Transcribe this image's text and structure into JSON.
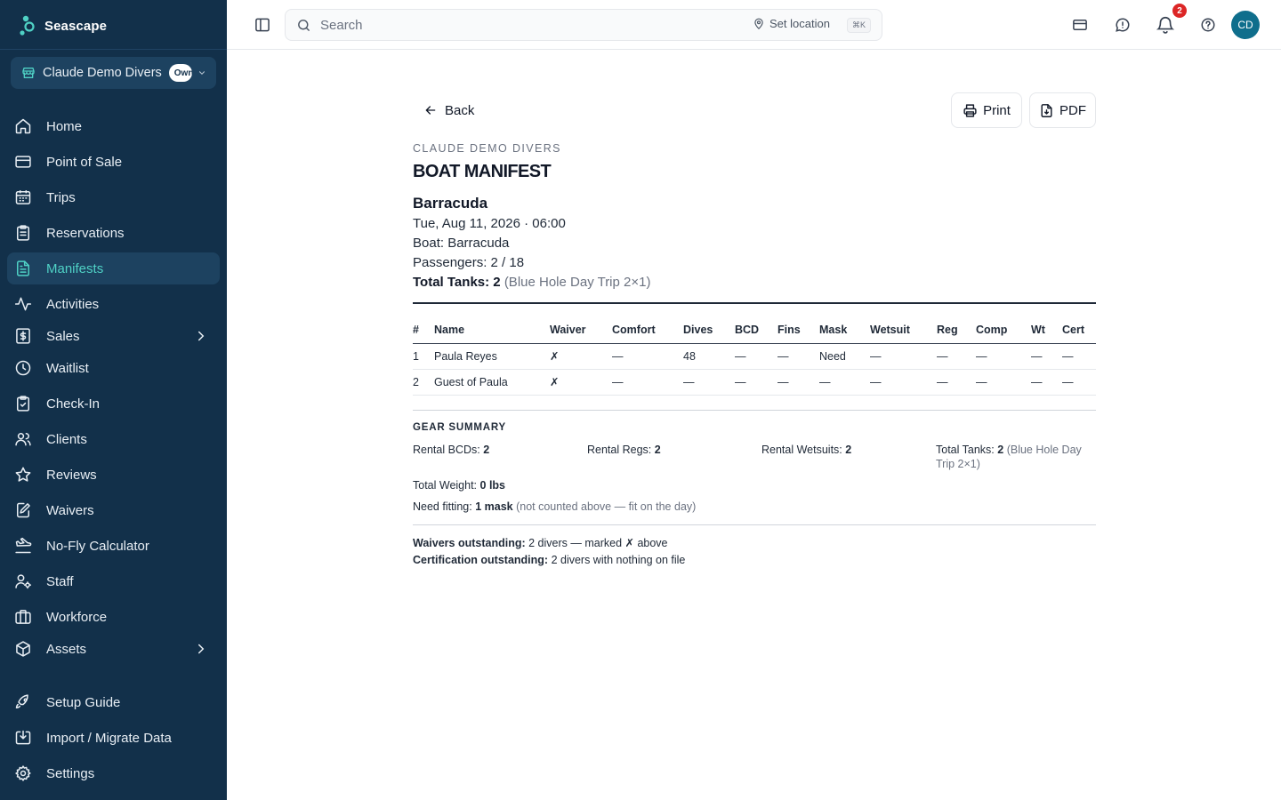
{
  "app": {
    "name": "Seascape"
  },
  "org_switcher": {
    "name": "Claude Demo Divers",
    "role_badge": "Owner"
  },
  "sidebar": {
    "items": [
      {
        "label": "Home",
        "icon": "home-icon"
      },
      {
        "label": "Point of Sale",
        "icon": "credit-card-icon"
      },
      {
        "label": "Trips",
        "icon": "calendar-icon"
      },
      {
        "label": "Reservations",
        "icon": "clipboard-icon"
      },
      {
        "label": "Manifests",
        "icon": "document-icon",
        "active": true
      },
      {
        "label": "Activities",
        "icon": "activity-icon"
      },
      {
        "label": "Sales",
        "icon": "dollar-icon",
        "expandable": true
      },
      {
        "label": "Waitlist",
        "icon": "clock-icon"
      },
      {
        "label": "Check-In",
        "icon": "clipboard-check-icon"
      },
      {
        "label": "Clients",
        "icon": "users-icon"
      },
      {
        "label": "Reviews",
        "icon": "star-icon"
      },
      {
        "label": "Waivers",
        "icon": "edit-document-icon"
      },
      {
        "label": "No-Fly Calculator",
        "icon": "plane-landing-icon"
      },
      {
        "label": "Staff",
        "icon": "user-cog-icon"
      },
      {
        "label": "Workforce",
        "icon": "briefcase-icon"
      },
      {
        "label": "Assets",
        "icon": "box-icon",
        "expandable": true
      },
      {
        "label": "Setup Guide",
        "icon": "rocket-icon"
      },
      {
        "label": "Import / Migrate Data",
        "icon": "import-icon"
      },
      {
        "label": "Settings",
        "icon": "gear-icon"
      }
    ]
  },
  "topbar": {
    "search_placeholder": "Search",
    "shortcut": "⌘K",
    "set_location": "Set location",
    "notification_count": "2",
    "avatar_initials": "CD"
  },
  "page": {
    "back_label": "Back",
    "print_label": "Print",
    "pdf_label": "PDF",
    "org_caps": "CLAUDE DEMO DIVERS",
    "title": "BOAT MANIFEST",
    "trip_name": "Barracuda",
    "datetime": "Tue, Aug 11, 2026 · 06:00",
    "boat": "Boat: Barracuda",
    "passengers": "Passengers: 2 / 18",
    "total_tanks_label": "Total Tanks:",
    "total_tanks_value": "2",
    "total_tanks_note": "(Blue Hole Day Trip 2×1)"
  },
  "manifest_table": {
    "columns": [
      "#",
      "Name",
      "Waiver",
      "Comfort",
      "Dives",
      "BCD",
      "Fins",
      "Mask",
      "Wetsuit",
      "Reg",
      "Comp",
      "Wt",
      "Cert"
    ],
    "rows": [
      [
        "1",
        "Paula Reyes",
        "✗",
        "—",
        "48",
        "—",
        "—",
        "Need",
        "—",
        "—",
        "—",
        "—",
        "—"
      ],
      [
        "2",
        "Guest of Paula",
        "✗",
        "—",
        "—",
        "—",
        "—",
        "—",
        "—",
        "—",
        "—",
        "—",
        "—"
      ]
    ]
  },
  "gear_summary": {
    "title": "GEAR SUMMARY",
    "rental_bcds_label": "Rental BCDs:",
    "rental_bcds_value": "2",
    "rental_regs_label": "Rental Regs:",
    "rental_regs_value": "2",
    "rental_wetsuits_label": "Rental Wetsuits:",
    "rental_wetsuits_value": "2",
    "total_tanks_label": "Total Tanks:",
    "total_tanks_value": "2",
    "total_tanks_note": "(Blue Hole Day Trip 2×1)",
    "total_weight_label": "Total Weight:",
    "total_weight_value": "0 lbs",
    "need_fitting_label": "Need fitting:",
    "need_fitting_value": "1 mask",
    "need_fitting_note": "(not counted above — fit on the day)"
  },
  "outstanding": {
    "waivers_label": "Waivers outstanding:",
    "waivers_text": "2 divers — marked ✗ above",
    "cert_label": "Certification outstanding:",
    "cert_text": "2 divers with nothing on file"
  }
}
